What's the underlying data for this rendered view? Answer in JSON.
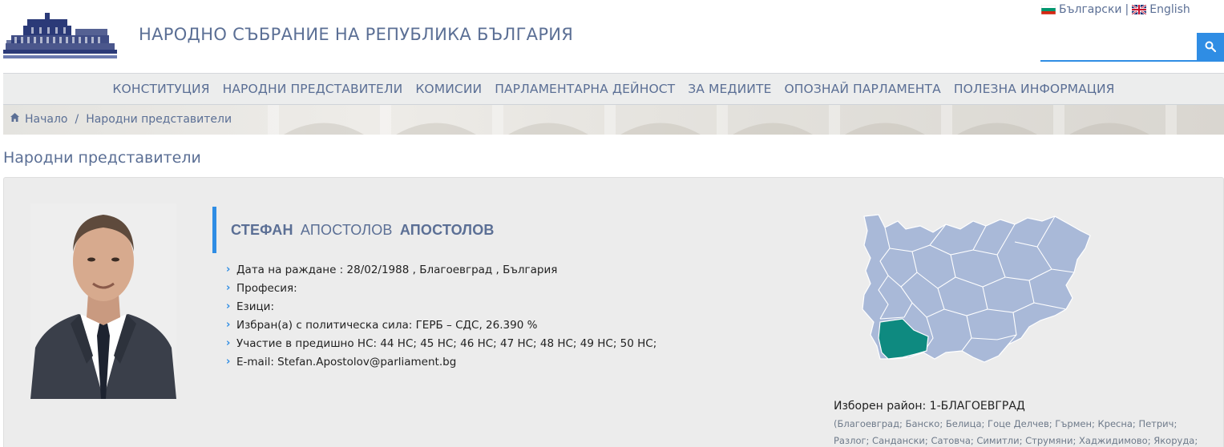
{
  "header": {
    "site_title": "НАРОДНО СЪБРАНИЕ НА РЕПУБЛИКА БЪЛГАРИЯ",
    "lang_bg": "Български",
    "lang_separator": "|",
    "lang_en": "English",
    "search_placeholder": ""
  },
  "nav": {
    "items": [
      "КОНСТИТУЦИЯ",
      "НАРОДНИ ПРЕДСТАВИТЕЛИ",
      "КОМИСИИ",
      "ПАРЛАМЕНТАРНА ДЕЙНОСТ",
      "ЗА МЕДИИТЕ",
      "ОПОЗНАЙ ПАРЛАМЕНТА",
      "ПОЛЕЗНА ИНФОРМАЦИЯ"
    ]
  },
  "breadcrumb": {
    "home": "Начало",
    "separator": "/",
    "current": "Народни представители"
  },
  "page": {
    "title": "Народни представители"
  },
  "mp": {
    "first_name": "СТЕФАН",
    "middle_name": "АПОСТОЛОВ",
    "last_name": "АПОСТОЛОВ",
    "facts": [
      "Дата на раждане : 28/02/1988 , Благоевград , България",
      "Професия:",
      "Езици:",
      "Избран(а) с политическа сила: ГЕРБ – СДС, 26.390 %",
      "Участие в предишно НС: 44 НС; 45 НС; 46 НС; 47 НС; 48 НС; 49 НС; 50 НС;",
      "E-mail: Stefan.Apostolov@parliament.bg"
    ],
    "district_label": "Изборен район: 1-БЛАГОЕВГРАД",
    "district_municipalities": "(Благоевград; Банско; Белица; Гоце Делчев; Гърмен; Кресна; Петрич; Разлог; Сандански; Сатовча; Симитли; Струмяни; Хаджидимово; Якоруда; )"
  },
  "colors": {
    "brand_text": "#5b6f95",
    "accent_blue": "#2f8de4",
    "map_base": "#a9b9d8",
    "map_highlight": "#0e8a80"
  }
}
